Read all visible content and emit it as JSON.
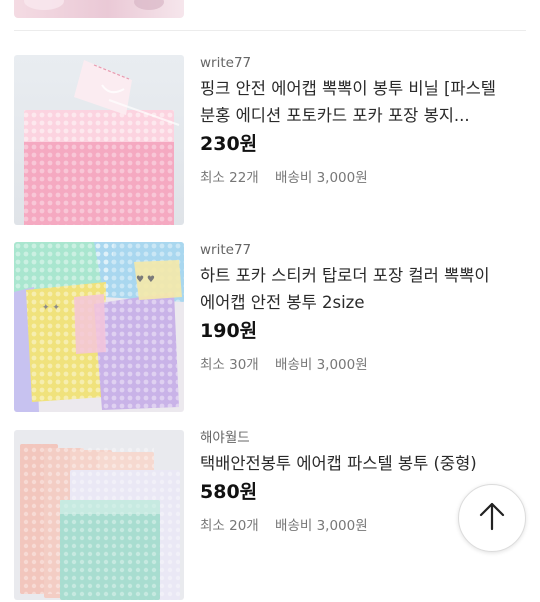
{
  "products": [
    {
      "seller": "write77",
      "title": "핑크 안전 에어캡 뽁뽁이 봉투 비닐 [파스텔 분홍 에디션 포토카드 포카 포장 봉지...",
      "price": "230원",
      "min_qty": "최소 22개",
      "shipping": "배송비 3,000원"
    },
    {
      "seller": "write77",
      "title": "하트 포카 스티커 탑로더 포장 컬러 뽁뽁이 에어캡 안전 봉투 2size",
      "price": "190원",
      "min_qty": "최소 30개",
      "shipping": "배송비 3,000원"
    },
    {
      "seller": "해야월드",
      "title": "택배안전봉투 에어캡 파스텔 봉투 (중형)",
      "price": "580원",
      "min_qty": "최소 20개",
      "shipping": "배송비 3,000원"
    }
  ],
  "scroll_top_icon": "arrow-up-icon"
}
